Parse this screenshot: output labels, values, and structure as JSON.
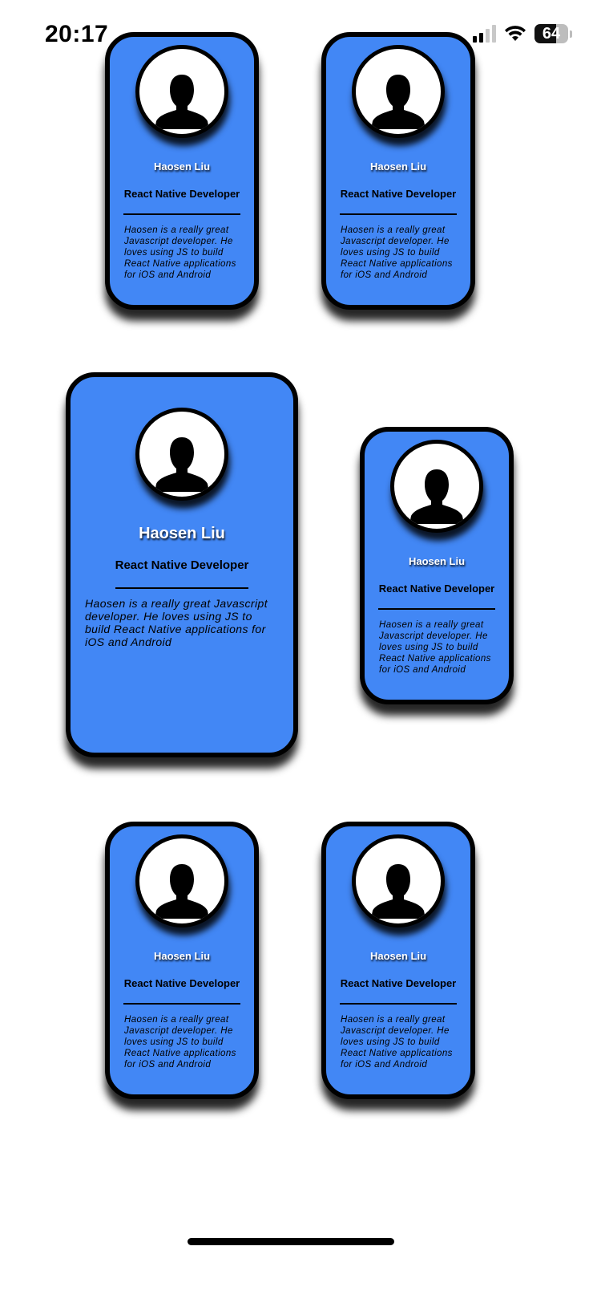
{
  "status_bar": {
    "time": "20:17",
    "battery": "64"
  },
  "cards": [
    {
      "name": "Haosen Liu",
      "role": "React Native Developer",
      "bio": "Haosen is a really great Javascript developer. He loves using JS to build React Native applications for iOS and Android"
    },
    {
      "name": "Haosen Liu",
      "role": "React Native Developer",
      "bio": "Haosen is a really great Javascript developer. He loves using JS to build React Native applications for iOS and Android"
    },
    {
      "name": "Haosen Liu",
      "role": "React Native Developer",
      "bio": "Haosen is a really great Javascript developer. He loves using JS to build React Native applications for iOS and Android"
    },
    {
      "name": "Haosen Liu",
      "role": "React Native Developer",
      "bio": "Haosen is a really great Javascript developer. He loves using JS to build React Native applications for iOS and Android"
    },
    {
      "name": "Haosen Liu",
      "role": "React Native Developer",
      "bio": "Haosen is a really great Javascript developer. He loves using JS to build React Native applications for iOS and Android"
    },
    {
      "name": "Haosen Liu",
      "role": "React Native Developer",
      "bio": "Haosen is a really great Javascript developer. He loves using JS to build React Native applications for iOS and Android"
    }
  ],
  "theme": {
    "card_color": "#4287f5",
    "border_color": "#000000",
    "avatar_bg": "#ffffff"
  },
  "icons": {
    "avatar": "person-silhouette-icon",
    "signal": "cellular-signal-icon",
    "wifi": "wifi-icon",
    "battery": "battery-icon"
  }
}
